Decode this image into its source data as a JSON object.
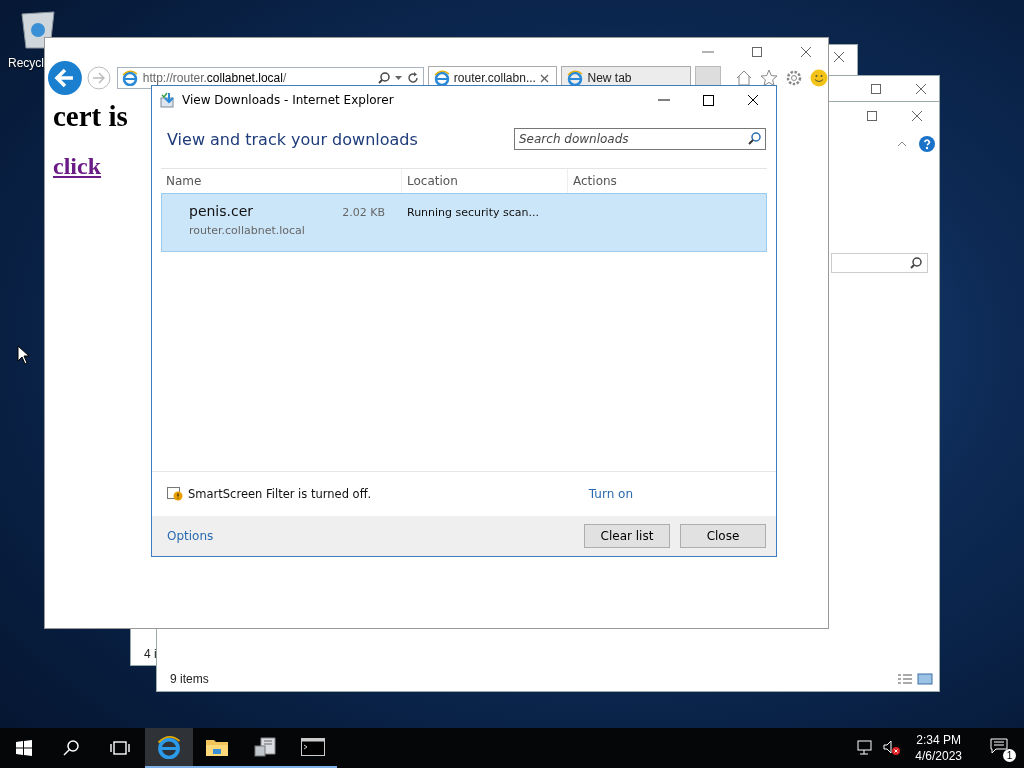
{
  "desktop": {
    "icons": [
      {
        "label": "Recycl"
      }
    ]
  },
  "explorer_back": {
    "status_bar": "4 i"
  },
  "explorer_front": {
    "status_bar": "9 items"
  },
  "browser": {
    "address": {
      "prefix": "http://router.",
      "domain": "collabnet.local",
      "suffix": "/"
    },
    "tabs": [
      {
        "label": "router.collabn...",
        "selected": true
      },
      {
        "label": "New tab",
        "selected": false
      }
    ],
    "page": {
      "heading": "cert is",
      "link": "click"
    }
  },
  "downloads": {
    "title": "View Downloads - Internet Explorer",
    "heading": "View and track your downloads",
    "search": {
      "placeholder": "Search downloads"
    },
    "columns": [
      "Name",
      "Location",
      "Actions"
    ],
    "rows": [
      {
        "name": "penis.cer",
        "size": "2.02 KB",
        "source": "router.collabnet.local",
        "status": "Running security scan...",
        "selected": true
      }
    ],
    "smartscreen": "SmartScreen Filter is turned off.",
    "turn_on": "Turn on",
    "options": "Options",
    "buttons": [
      "Clear list",
      "Close"
    ]
  },
  "taskbar": {
    "apps": [
      {
        "kind": "ie",
        "active": true,
        "running": true
      },
      {
        "kind": "folder",
        "active": false,
        "running": true
      },
      {
        "kind": "server",
        "active": false,
        "running": true
      },
      {
        "kind": "console",
        "active": false,
        "running": true
      }
    ],
    "time": "2:34 PM",
    "date": "4/6/2023",
    "notifications": "1"
  }
}
